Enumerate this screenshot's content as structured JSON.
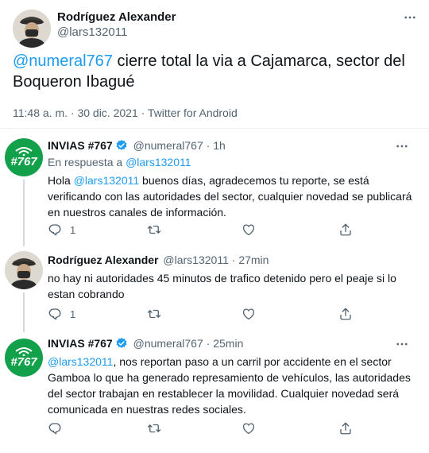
{
  "main_tweet": {
    "author_name": "Rodríguez Alexander",
    "author_handle": "@lars132011",
    "text_mention": "@numeral767",
    "text_body": " cierre total la via a Cajamarca, sector del Boqueron Ibagué",
    "timestamp": "11:48 a. m. · 30 dic. 2021 · Twitter for Android"
  },
  "replies": [
    {
      "author_name": "INVIAS #767",
      "author_handle": "@numeral767",
      "separator": "·",
      "time": "1h",
      "reply_to_prefix": "En respuesta a ",
      "reply_to_handle": "@lars132011",
      "text_prefix": "Hola ",
      "text_mention": "@lars132011",
      "text_body": " buenos días, agradecemos tu reporte, se está verificando con las autoridades del sector, cualquier novedad se publicará en nuestros canales de información.",
      "reply_count": "1",
      "avatar_text": "#767"
    },
    {
      "author_name": "Rodríguez Alexander",
      "author_handle": "@lars132011",
      "separator": "·",
      "time": "27min",
      "text_body": "no hay ni autoridades 45 minutos de trafico detenido pero el peaje si lo estan cobrando",
      "reply_count": "1"
    },
    {
      "author_name": "INVIAS #767",
      "author_handle": "@numeral767",
      "separator": "·",
      "time": "25min",
      "text_mention": "@lars132011",
      "text_body": ", nos reportan paso a un carril por accidente en el sector Gamboa lo que ha generado represamiento de vehículos, las autoridades del sector trabajan en restablecer la movilidad. Cualquier novedad será comunicada en nuestras redes sociales.",
      "avatar_text": "#767"
    }
  ],
  "icons": {
    "more": "more-horizontal-icon",
    "reply": "reply-icon",
    "retweet": "retweet-icon",
    "like": "heart-icon",
    "share": "share-icon",
    "verified": "verified-badge-icon"
  },
  "colors": {
    "accent": "#1d9bf0",
    "secondary_text": "#536471",
    "invias_green": "#12a04a"
  }
}
